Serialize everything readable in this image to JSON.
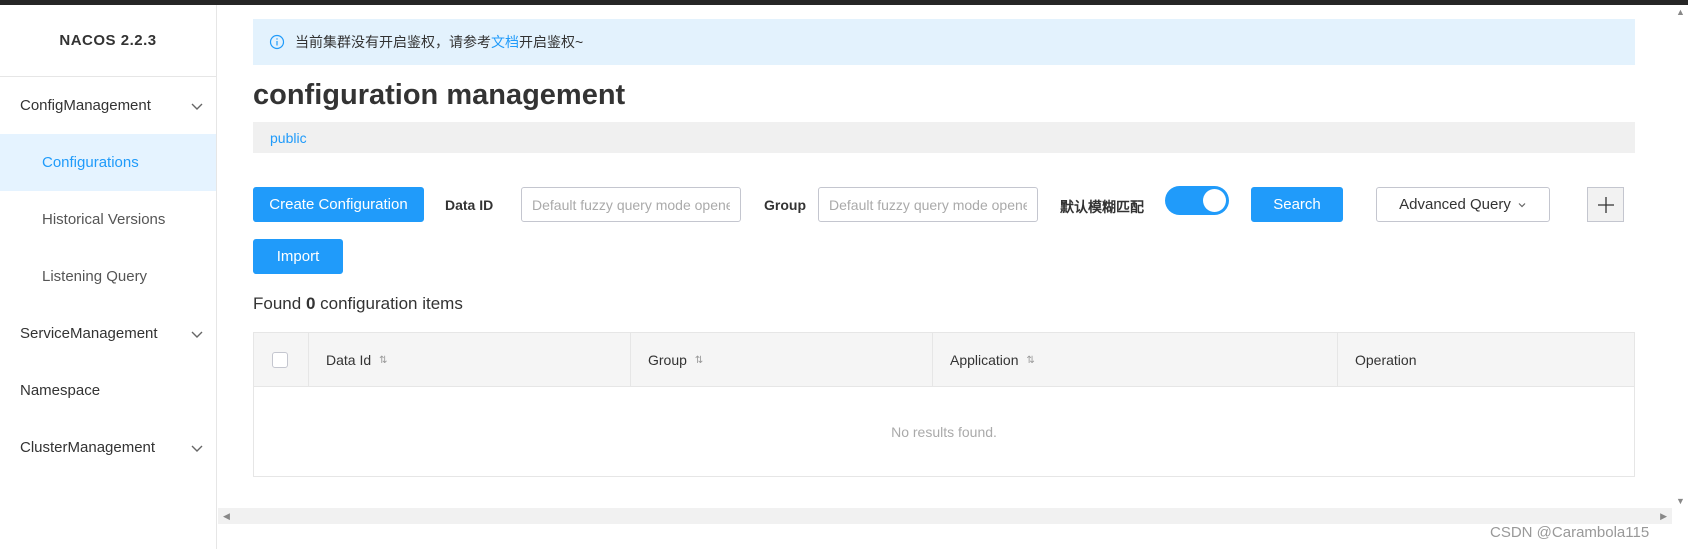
{
  "sidebar": {
    "brand": "NACOS 2.2.3",
    "groups": [
      {
        "label": "ConfigManagement"
      },
      {
        "label": "ServiceManagement"
      },
      {
        "label": "Namespace"
      },
      {
        "label": "ClusterManagement"
      }
    ],
    "config_items": [
      {
        "label": "Configurations"
      },
      {
        "label": "Historical Versions"
      },
      {
        "label": "Listening Query"
      }
    ]
  },
  "notice": {
    "prefix": "当前集群没有开启鉴权，请参考",
    "link": "文档",
    "suffix": "开启鉴权~"
  },
  "page": {
    "title": "configuration management",
    "namespace": "public"
  },
  "toolbar": {
    "create_label": "Create Configuration",
    "data_id_label": "Data ID",
    "data_id_placeholder": "Default fuzzy query mode opened",
    "group_label": "Group",
    "group_placeholder": "Default fuzzy query mode opened",
    "fuzzy_label": "默认模糊匹配",
    "fuzzy_enabled": true,
    "search_label": "Search",
    "advanced_label": "Advanced Query",
    "import_label": "Import"
  },
  "results": {
    "prefix": "Found",
    "count": "0",
    "suffix": "configuration items"
  },
  "table": {
    "columns": [
      "Data Id",
      "Group",
      "Application",
      "Operation"
    ],
    "empty_text": "No results found."
  },
  "watermark": "CSDN @Carambola115",
  "colors": {
    "primary": "#209bfa",
    "active_bg": "#e5f3ff",
    "notice_bg": "#e3f2fd"
  }
}
